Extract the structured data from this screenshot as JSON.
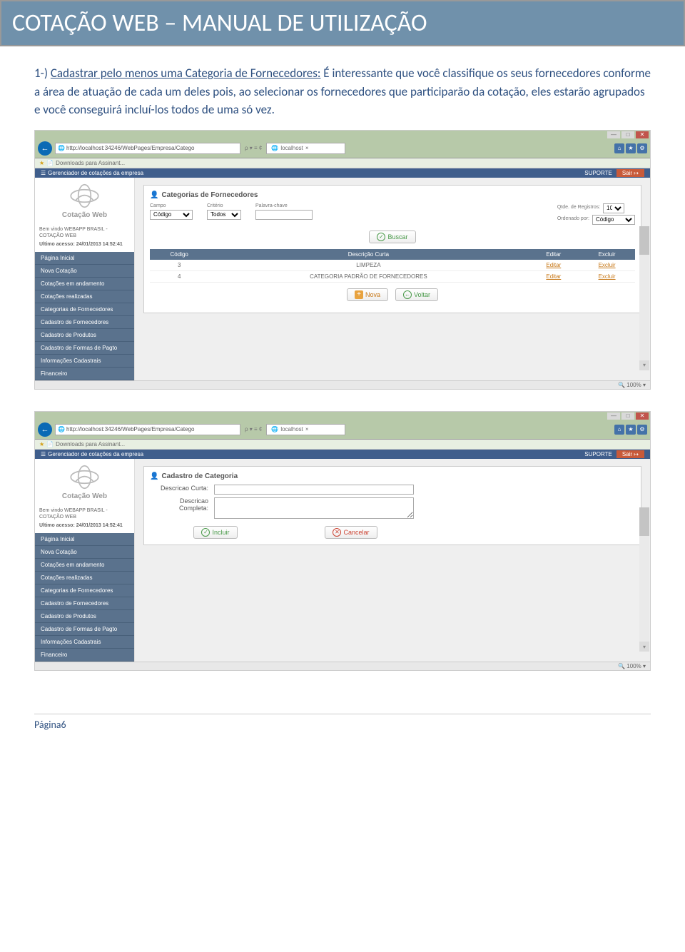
{
  "header": {
    "title": "COTAÇÃO WEB – MANUAL DE UTILIZAÇÃO"
  },
  "intro": {
    "lead": "1-) ",
    "underlined": "Cadastrar pelo menos uma Categoria de Fornecedores:",
    "rest": " É interessante que você classifique os seus fornecedores conforme a área de atuação de cada um deles pois, ao selecionar os fornecedores que participarão da cotação, eles estarão agrupados e você conseguirá incluí-los todos de uma só vez."
  },
  "browser": {
    "url": "http://localhost:34246/WebPages/Empresa/Catego",
    "search_extras": "ρ ▾ ≡ ¢",
    "tab": "localhost",
    "bookmark": "Downloads para Assinant..."
  },
  "app": {
    "header_left": "Gerenciador de cotações da empresa",
    "suporte": "SUPORTE",
    "sair": "Sair",
    "logo_text": "Cotação Web",
    "welcome": "Bem vindo WEBAPP BRASIL - COTAÇÃO WEB",
    "last_access": "Ultimo acesso: 24/01/2013 14:52:41",
    "menu": [
      "Página Inicial",
      "Nova Cotação",
      "Cotações em andamento",
      "Cotações realizadas",
      "Categorias de Fornecedores",
      "Cadastro de Fornecedores",
      "Cadastro de Produtos",
      "Cadastro de Formas de Pagto",
      "Informações Cadastrais",
      "Financeiro"
    ]
  },
  "panel1": {
    "title": "Categorias de Fornecedores",
    "filters": {
      "campo_label": "Campo",
      "campo_value": "Código",
      "criterio_label": "Critério",
      "criterio_value": "Todos",
      "palavra_label": "Palavra-chave",
      "qtde_label": "Qtde. de Registros:",
      "qtde_value": "10",
      "ordenado_label": "Ordenado por:",
      "ordenado_value": "Código"
    },
    "buscar": "Buscar",
    "table": {
      "headers": [
        "Código",
        "Descrição Curta",
        "Editar",
        "Excluir"
      ],
      "rows": [
        {
          "codigo": "3",
          "desc": "LIMPEZA",
          "editar": "Editar",
          "excluir": "Excluir"
        },
        {
          "codigo": "4",
          "desc": "CATEGORIA PADRÃO DE FORNECEDORES",
          "editar": "Editar",
          "excluir": "Excluir"
        }
      ]
    },
    "nova": "Nova",
    "voltar": "Voltar"
  },
  "panel2": {
    "title": "Cadastro de Categoria",
    "desc_curta_label": "Descricao Curta:",
    "desc_completa_label": "Descricao Completa:",
    "incluir": "Incluir",
    "cancelar": "Cancelar"
  },
  "zoom": "100%",
  "footer": "Página6"
}
